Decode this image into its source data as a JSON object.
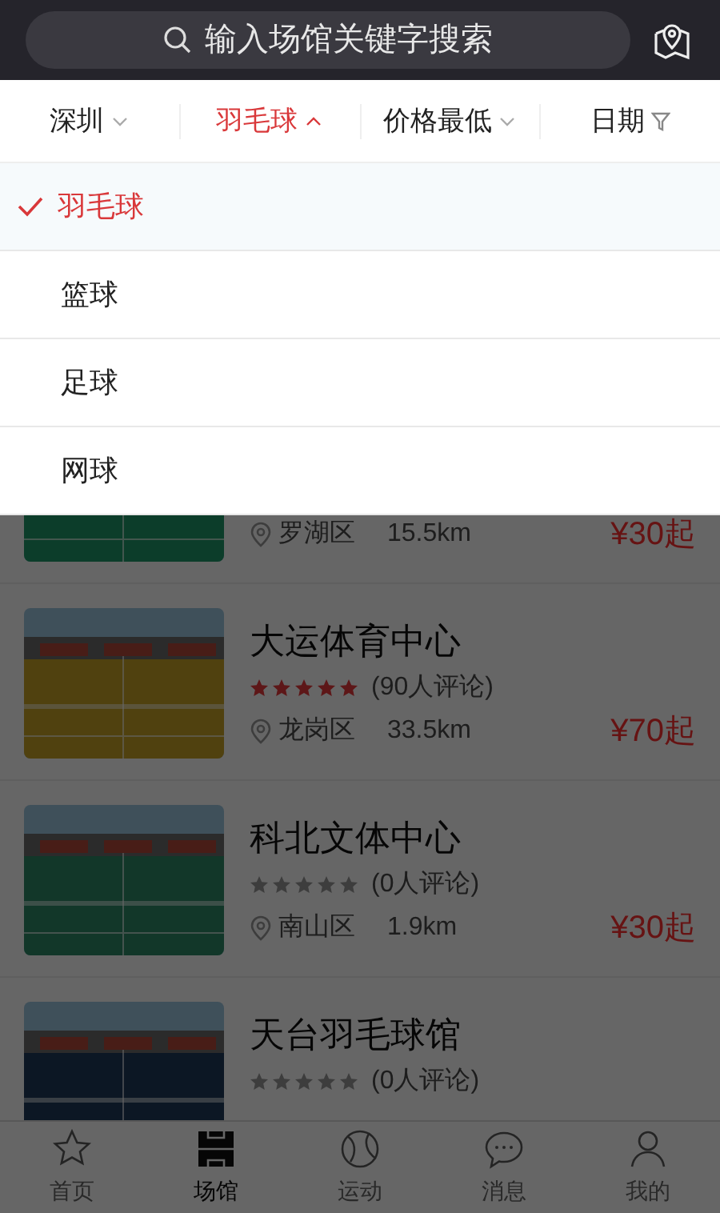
{
  "search": {
    "placeholder": "输入场馆关键字搜索"
  },
  "filters": [
    {
      "label": "深圳",
      "kind": "dropdown",
      "expanded": false
    },
    {
      "label": "羽毛球",
      "kind": "dropdown",
      "expanded": true
    },
    {
      "label": "价格最低",
      "kind": "dropdown",
      "expanded": false
    },
    {
      "label": "日期",
      "kind": "filter"
    }
  ],
  "dropdown": [
    {
      "label": "羽毛球",
      "selected": true
    },
    {
      "label": "篮球",
      "selected": false
    },
    {
      "label": "足球",
      "selected": false
    },
    {
      "label": "网球",
      "selected": false
    }
  ],
  "venues": [
    {
      "district": "罗湖区",
      "distance": "15.5km",
      "price": "¥30起"
    },
    {
      "name": "大运体育中心",
      "stars": 5,
      "reviews": "(90人评论)",
      "district": "龙岗区",
      "distance": "33.5km",
      "price": "¥70起"
    },
    {
      "name": "科北文体中心",
      "stars": 0,
      "reviews": "(0人评论)",
      "district": "南山区",
      "distance": "1.9km",
      "price": "¥30起"
    },
    {
      "name": "天台羽毛球馆",
      "stars": 0,
      "reviews": "(0人评论)"
    }
  ],
  "tabs": [
    {
      "label": "首页",
      "kind": "star",
      "selected": false
    },
    {
      "label": "场馆",
      "kind": "court",
      "selected": true
    },
    {
      "label": "运动",
      "kind": "ball",
      "selected": false
    },
    {
      "label": "消息",
      "kind": "chat",
      "selected": false
    },
    {
      "label": "我的",
      "kind": "person",
      "selected": false
    }
  ]
}
